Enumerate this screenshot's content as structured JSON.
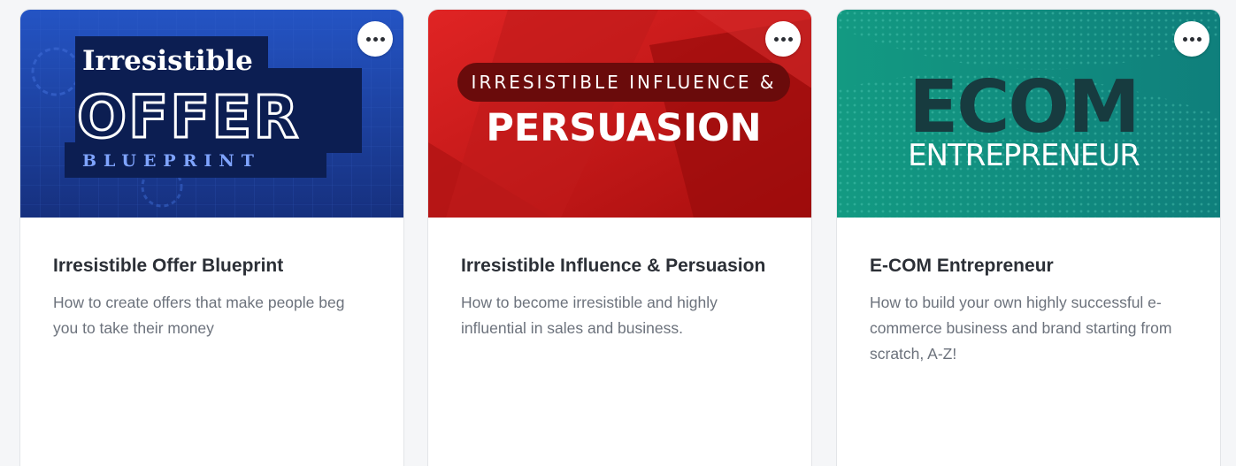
{
  "courses": [
    {
      "thumbnail": {
        "line1": "Irresistible",
        "line2": "OFFER",
        "line3": "BLUEPRINT",
        "bg_color": "#1d3f9c",
        "accent": "#0c1e52"
      },
      "more_icon": "more-horizontal-icon",
      "title": "Irresistible Offer Blueprint",
      "description": "How to create offers that make people beg you to take their money"
    },
    {
      "thumbnail": {
        "line1": "IRRESISTIBLE INFLUENCE &",
        "line2": "PERSUASION",
        "bg_color": "#c81818",
        "accent": "#6a0b0b"
      },
      "more_icon": "more-horizontal-icon",
      "title": "Irresistible Influence & Persuasion",
      "description": "How to become irresistible and highly influential in sales and business."
    },
    {
      "thumbnail": {
        "line1": "ECOM",
        "line2": "ENTREPRENEUR",
        "bg_color": "#0e8a7a",
        "accent": "#173b3f"
      },
      "more_icon": "more-horizontal-icon",
      "title": "E-COM Entrepreneur",
      "description": "How to build your own highly successful e-commerce business and brand starting from scratch, A-Z!"
    }
  ]
}
